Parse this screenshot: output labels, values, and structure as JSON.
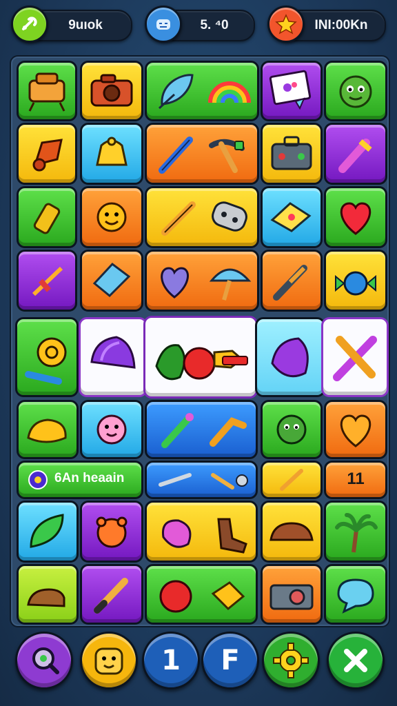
{
  "hud": {
    "left_label": "9uıok",
    "middle_label": "5. ⁴0",
    "right_label": "INI:00Kn",
    "left_icon": "tools-icon",
    "middle_icon": "face-mask-icon",
    "right_icon": "star-icon",
    "colors": {
      "left": "#7ed321",
      "middle": "#3a8fe0",
      "right": "#f2552c"
    }
  },
  "board": {
    "bar_left_label": "6An heaain",
    "counter_label": "11"
  },
  "bottom_bar": {
    "buttons": [
      {
        "icon": "search-icon",
        "color": "#8e3bd1"
      },
      {
        "icon": "bear-face-icon",
        "color": "#f6b60d"
      },
      {
        "label": "1",
        "icon": "number-icon",
        "color": "#1e5fb8"
      },
      {
        "label": "F",
        "icon": "letter-icon",
        "color": "#1e5fb8"
      },
      {
        "icon": "gear-icon",
        "color": "#2fae2f"
      },
      {
        "icon": "close-icon",
        "color": "#27b23a"
      }
    ]
  }
}
